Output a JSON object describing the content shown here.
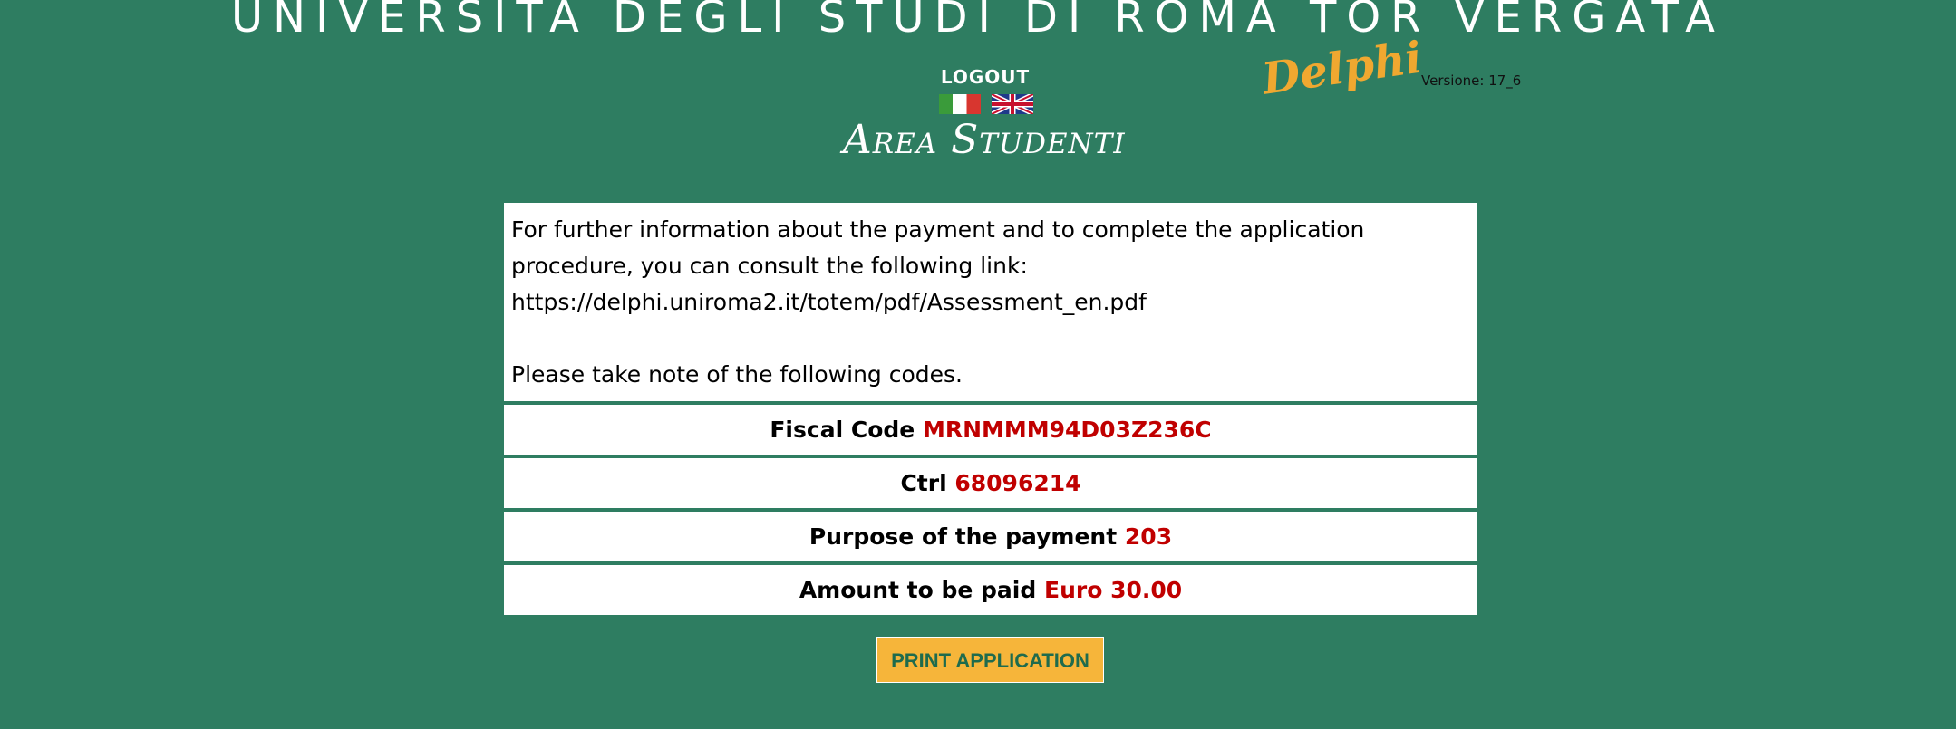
{
  "header": {
    "university_title": "UNIVERSITÀ DEGLI STUDI DI ROMA TOR VERGATA",
    "logout_label": "LOGOUT",
    "area_title": "Area Studenti",
    "logo_text": "Delphi",
    "version_text": "Versione: 17_6",
    "languages": [
      {
        "name": "italian-flag-icon",
        "code": "it"
      },
      {
        "name": "uk-flag-icon",
        "code": "en"
      }
    ]
  },
  "content": {
    "info_line1": "For further information about the payment and to complete the application",
    "info_line2": "procedure, you can consult the following link:",
    "info_link": "https://delphi.uniroma2.it/totem/pdf/Assessment_en.pdf",
    "info_note": "Please take note of the following codes.",
    "codes": [
      {
        "label": "Fiscal Code",
        "value": "MRNMMM94D03Z236C"
      },
      {
        "label": "Ctrl",
        "value": "68096214"
      },
      {
        "label": "Purpose of the payment",
        "value": "203"
      },
      {
        "label": "Amount to be paid",
        "value": "Euro 30.00"
      }
    ]
  },
  "actions": {
    "print_label": "PRINT APPLICATION"
  },
  "colors": {
    "background": "#2e7d61",
    "value_red": "#c00000",
    "button_orange": "#f6b53a",
    "logo_orange": "#f0a830"
  }
}
